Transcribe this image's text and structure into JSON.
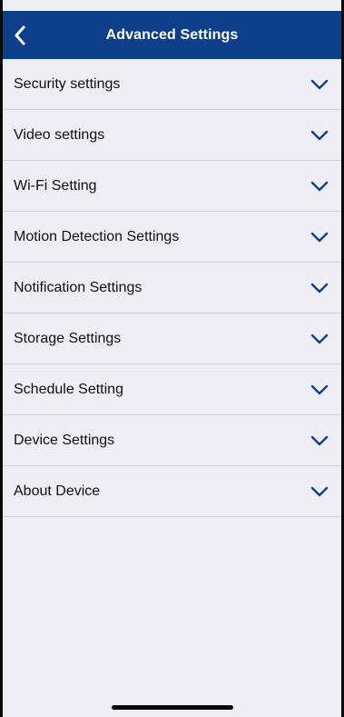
{
  "header": {
    "title": "Advanced Settings",
    "back_icon": "chevron-left-icon",
    "background_color": "#0d3f8a"
  },
  "settings": {
    "expand_icon": "chevron-down-icon",
    "accent_color": "#0d3f8a",
    "items": [
      {
        "label": "Security settings"
      },
      {
        "label": "Video settings"
      },
      {
        "label": "Wi-Fi Setting"
      },
      {
        "label": "Motion Detection Settings"
      },
      {
        "label": "Notification Settings"
      },
      {
        "label": "Storage Settings"
      },
      {
        "label": "Schedule Setting"
      },
      {
        "label": "Device Settings"
      },
      {
        "label": "About Device"
      }
    ]
  }
}
